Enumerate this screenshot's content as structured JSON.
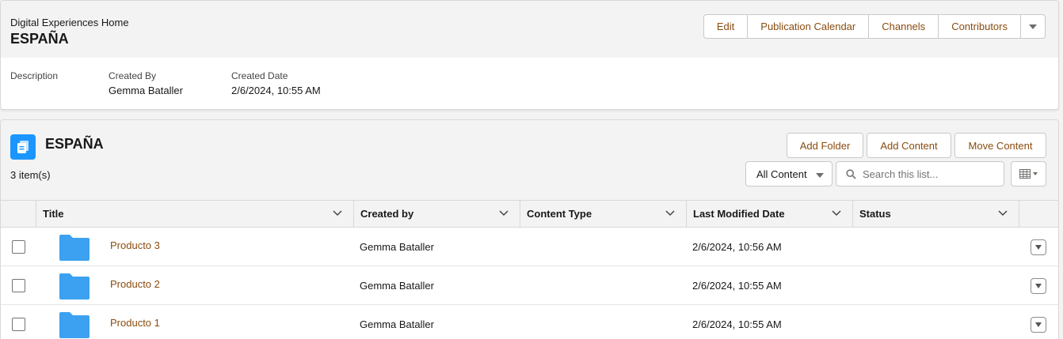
{
  "header": {
    "breadcrumb": "Digital Experiences Home",
    "title": "ESPAÑA",
    "buttons": [
      "Edit",
      "Publication Calendar",
      "Channels",
      "Contributors"
    ],
    "more_icon": "chevron-down-icon",
    "fields": {
      "description_label": "Description",
      "created_by_label": "Created By",
      "created_by_value": "Gemma Bataller",
      "created_date_label": "Created Date",
      "created_date_value": "2/6/2024, 10:55 AM"
    }
  },
  "list": {
    "title": "ESPAÑA",
    "icon": "content-document-icon",
    "item_count": "3 item(s)",
    "actions": [
      "Add Folder",
      "Add Content",
      "Move Content"
    ],
    "filter_selected": "All Content",
    "search_placeholder": "Search this list...",
    "columns": [
      "Title",
      "Created by",
      "Content Type",
      "Last Modified Date",
      "Status"
    ],
    "rows": [
      {
        "title": "Producto 3",
        "created_by": "Gemma Bataller",
        "content_type": "",
        "last_modified": "2/6/2024, 10:56 AM",
        "status": ""
      },
      {
        "title": "Producto 2",
        "created_by": "Gemma Bataller",
        "content_type": "",
        "last_modified": "2/6/2024, 10:55 AM",
        "status": ""
      },
      {
        "title": "Producto 1",
        "created_by": "Gemma Bataller",
        "content_type": "",
        "last_modified": "2/6/2024, 10:55 AM",
        "status": ""
      }
    ]
  },
  "colors": {
    "accent_icon": "#1b96ff",
    "folder": "#3ba1f0",
    "link": "#8a4c0f"
  }
}
